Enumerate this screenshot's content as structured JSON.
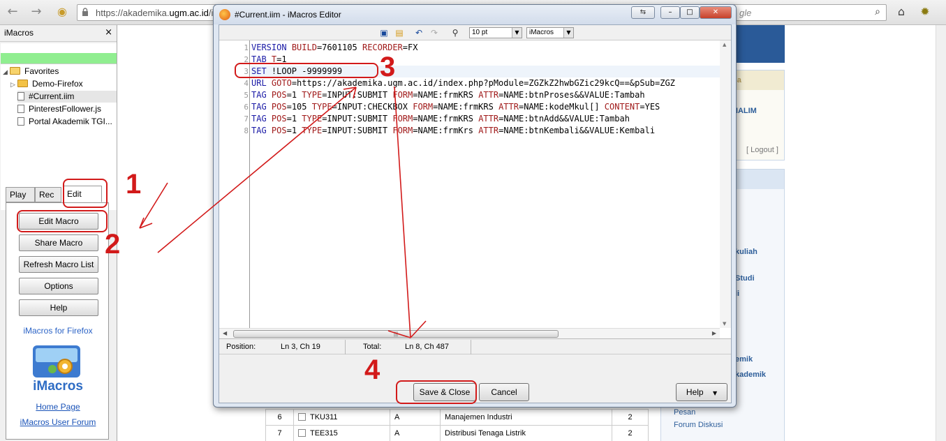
{
  "browser": {
    "url_plain_start": "https://akademika.",
    "url_host": "ugm.ac.id",
    "url_plain_end": "/in",
    "search_text": "gle"
  },
  "sidebar": {
    "title": "iMacros",
    "close": "×",
    "tree": [
      {
        "label": "Favorites",
        "type": "folder-open"
      },
      {
        "label": "Demo-Firefox",
        "type": "folder"
      },
      {
        "label": "#Current.iim",
        "type": "file"
      },
      {
        "label": "PinterestFollower.js",
        "type": "file"
      },
      {
        "label": "Portal Akademik TGI...",
        "type": "file"
      }
    ],
    "tabs": [
      "Play",
      "Rec",
      "Edit"
    ],
    "buttons": [
      "Edit Macro",
      "Share Macro",
      "Refresh Macro List",
      "Options",
      "Help"
    ],
    "for_firefox": "iMacros for Firefox",
    "logo_text": "iMacros",
    "home_page": "Home Page",
    "user_forum": "iMacros User Forum"
  },
  "editor": {
    "title": "#Current.iim - iMacros Editor",
    "font_size": "10 pt",
    "syntax": "iMacros",
    "lines": [
      "VERSION BUILD=7601105 RECORDER=FX",
      "TAB T=1",
      "SET !LOOP -9999999",
      "URL GOTO=https://akademika.ugm.ac.id/index.php?pModule=ZGZkZ2hwbGZic29kcQ==&pSub=ZGZ",
      "TAG POS=1 TYPE=INPUT:SUBMIT FORM=NAME:frmKRS ATTR=NAME:btnProses&&VALUE:Tambah",
      "TAG POS=105 TYPE=INPUT:CHECKBOX FORM=NAME:frmKRS ATTR=NAME:kodeMkul[] CONTENT=YES",
      "TAG POS=1 TYPE=INPUT:SUBMIT FORM=NAME:frmKRS ATTR=NAME:btnAdd&&VALUE:Tambah",
      "TAG POS=1 TYPE=INPUT:SUBMIT FORM=NAME:frmKrs ATTR=NAME:btnKembali&&VALUE:Kembali"
    ],
    "line_numbers": [
      "1",
      "2",
      "3",
      "4",
      "5",
      "6",
      "7",
      "8"
    ],
    "current_line": 3,
    "status": {
      "position_label": "Position:",
      "position_value": "Ln 3, Ch 19",
      "total_label": "Total:",
      "total_value": "Ln 8, Ch 487"
    },
    "buttons": {
      "save_close": "Save & Close",
      "cancel": "Cancel",
      "help": "Help"
    }
  },
  "background_page": {
    "right_items": [
      "na",
      "HALIM",
      "[ Logout ]",
      "kuliah",
      "Studi",
      "li",
      "emik",
      "kademik",
      "Pesan",
      "Forum Diskusi"
    ],
    "table_rows": [
      {
        "no": "6",
        "code": "TKU311",
        "class": "A",
        "name": "Manajemen Industri",
        "sks": "2"
      },
      {
        "no": "7",
        "code": "TEE315",
        "class": "A",
        "name": "Distribusi Tenaga Listrik",
        "sks": "2"
      }
    ]
  },
  "annotations": [
    "1",
    "2",
    "3",
    "4"
  ],
  "colors": {
    "annotation": "#d21a1a",
    "keyword": "#1a1aa6",
    "param": "#a01a1a",
    "link": "#1a53b8",
    "green_bar": "#90ee90"
  }
}
